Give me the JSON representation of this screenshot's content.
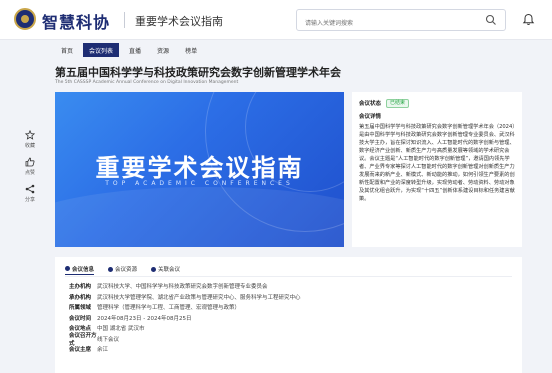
{
  "header": {
    "logo_text": "智慧科协",
    "page_subtitle": "重要学术会议指南",
    "search_placeholder": "请输入关键词搜索"
  },
  "nav": {
    "items": [
      {
        "label": "首页",
        "active": false
      },
      {
        "label": "会议列表",
        "active": true
      },
      {
        "label": "直播",
        "active": false
      },
      {
        "label": "资源",
        "active": false
      },
      {
        "label": "榜单",
        "active": false
      }
    ]
  },
  "conference": {
    "title": "第五届中国科学学与科技政策研究会数字创新管理学术年会",
    "subtitle_en": "The 5th CASSSP Academic Annual Conference on Digital Innovation Management"
  },
  "side_actions": {
    "favorite": "收藏",
    "like": "点赞",
    "share": "分享"
  },
  "banner": {
    "title": "重要学术会议指南",
    "subtitle": "TOP ACADEMIC CONFERENCES"
  },
  "info": {
    "status_label": "会议状态",
    "status_value": "已结束",
    "detail_label": "会议详情",
    "description": "第五届中国科学学与科技政策研究会数字创新管理学术年会（2024）是由中国科学学与科技政策研究会数字创新管理专业委员会、武汉科技大学主办，旨在探讨知识流入、人工智能时代的数字创新与管理、数字经济产业创新、新质生产力与高质量发展等领域的学术研究会议。会议主题是“人工智能时代的数字创新管理”，邀请国内领先学者、产业界专家等探讨人工智能时代的数字创新管理对创新质生产力发展而来的新产业、新模式、新动能的推动，如何引领生产要素的创新性配置和产业的深度转型升级，实现劳动者、劳动资料、劳动对象及其优化组合跃升，为实现“十四五”创新体系建设目标和任务建言献策。"
  },
  "details": {
    "tabs": [
      {
        "label": "会议信息",
        "active": true
      },
      {
        "label": "会议资源",
        "active": false
      },
      {
        "label": "关联会议",
        "active": false
      }
    ],
    "rows": [
      {
        "key": "主办机构",
        "value": "武汉科技大学、中国科学学与科技政策研究会数字创新管理专业委员会"
      },
      {
        "key": "承办机构",
        "value": "武汉科技大学管理学院、湖北省产业政策与管理研究中心、服务科学与工程研究中心"
      },
      {
        "key": "所属领域",
        "value": "管理科学（管理科学与工程、工商管理、宏观管理与政策）"
      },
      {
        "key": "会议时间",
        "value": "2024年08月23日 - 2024年08月25日"
      },
      {
        "key": "会议地点",
        "value": "中国 湖北省 武汉市"
      },
      {
        "key": "会议召开方式",
        "value": "线下会议"
      },
      {
        "key": "会议主席",
        "value": "余江"
      }
    ]
  },
  "colors": {
    "brand": "#1e2d73",
    "accent_gold": "#c9a64a",
    "banner_blue": "#2c6ee6",
    "status_green": "#28a745"
  }
}
